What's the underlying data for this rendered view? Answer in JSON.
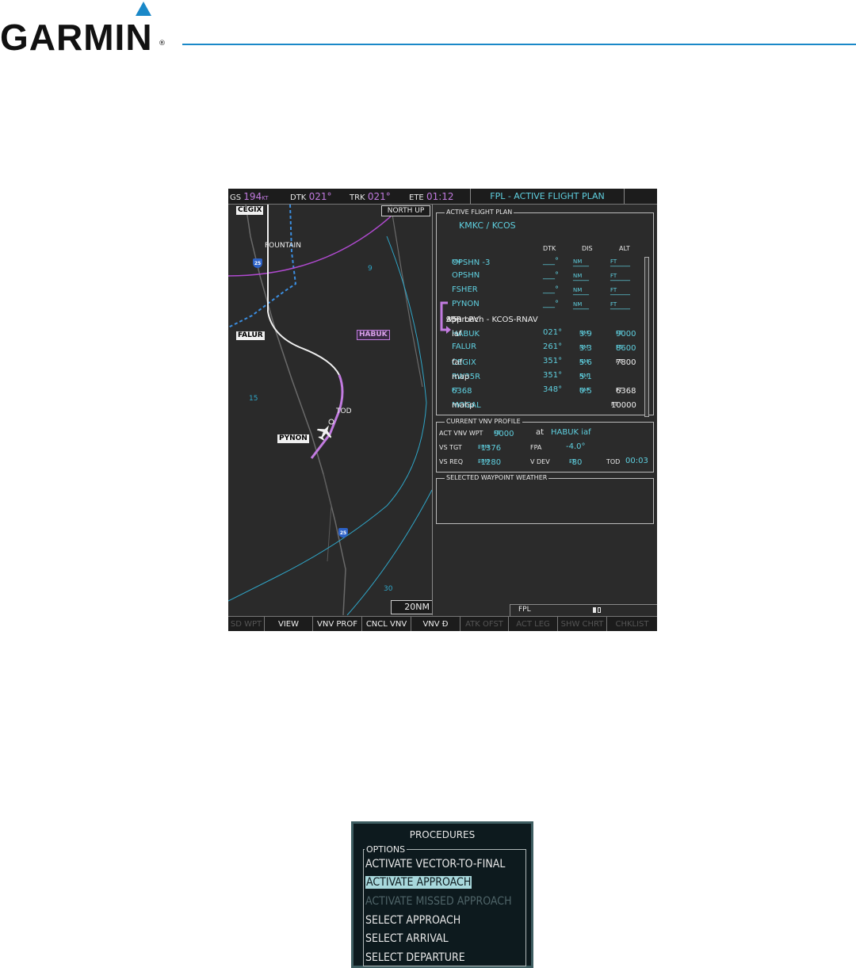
{
  "brand": {
    "logo_text": "GARMIN",
    "registered": "®"
  },
  "top_bar": {
    "gs_label": "GS",
    "gs_value": "194",
    "gs_unit": "KT",
    "dtk_label": "DTK",
    "dtk_value": "021°",
    "trk_label": "TRK",
    "trk_value": "021°",
    "ete_label": "ETE",
    "ete_value": "01:12",
    "page_title": "FPL - ACTIVE FLIGHT PLAN"
  },
  "map": {
    "orientation": "NORTH UP",
    "range": "20NM",
    "waypoints": {
      "cegix": "CEGIX",
      "falur": "FALUR",
      "habuk": "HABUK",
      "pynon": "PYNON"
    },
    "labels": {
      "fountain": "FOUNTAIN",
      "tod": "TOD",
      "ring_9": "9",
      "ring_15": "15",
      "ring_30": "30"
    },
    "highways": [
      "25",
      "25"
    ]
  },
  "flight_plan": {
    "title": "ACTIVE FLIGHT PLAN",
    "route": "KMKC / KCOS",
    "columns": [
      "DTK",
      "DIS",
      "ALT"
    ],
    "rows": [
      {
        "name": "OPSHN -3",
        "name_unit": "NM",
        "dtk": "___°",
        "dis": "____",
        "dis_unit": "NM",
        "alt": "_____",
        "alt_unit": "FT"
      },
      {
        "name": "OPSHN",
        "dtk": "___°",
        "dis": "____",
        "dis_unit": "NM",
        "alt": "_____",
        "alt_unit": "FT"
      },
      {
        "name": "FSHER",
        "dtk": "___°",
        "dis": "____",
        "dis_unit": "NM",
        "alt": "_____",
        "alt_unit": "FT"
      },
      {
        "name": "PYNON",
        "dtk": "___°",
        "dis": "____",
        "dis_unit": "NM",
        "alt": "_____",
        "alt_unit": "FT"
      }
    ],
    "approach_label": "Approach - KCOS-RNAV",
    "approach_gps": "GPS",
    "approach_suffix": "35R LPV",
    "approach_rows": [
      {
        "name": "HABUK",
        "tag": "iaf",
        "dtk": "021°",
        "dis": "3.9",
        "dis_unit": "NM",
        "alt": "9000",
        "alt_unit": "FT"
      },
      {
        "name": "FALUR",
        "tag": "",
        "dtk": "261°",
        "dis": "3.3",
        "dis_unit": "NM",
        "alt": "8600",
        "alt_unit": "FT"
      },
      {
        "name": "CEGIX",
        "tag": "faf",
        "dtk": "351°",
        "dis": "5.6",
        "dis_unit": "NM",
        "alt": "7800",
        "alt_unit": "FT"
      },
      {
        "name": "RW35R",
        "tag": "map",
        "dtk": "351°",
        "dis": "5.1",
        "dis_unit": "NM",
        "alt": "",
        "alt_unit": ""
      },
      {
        "name": "6368",
        "name_unit": "FT",
        "tag": "",
        "dtk": "348°",
        "dis": "0.5",
        "dis_unit": "NM",
        "alt": "6368",
        "alt_unit": "FT"
      },
      {
        "name": "MOGAL",
        "tag": "mahp",
        "dtk": "",
        "dis": "",
        "dis_unit": "",
        "alt": "10000",
        "alt_unit": "FT"
      }
    ]
  },
  "vnv_profile": {
    "title": "CURRENT VNV PROFILE",
    "act_label": "ACT VNV WPT",
    "act_value": "9000",
    "act_unit": "FT",
    "at_label": "at",
    "act_wpt": "HABUK iaf",
    "vs_tgt_label": "VS TGT",
    "vs_tgt_value": "-1376",
    "vs_tgt_unit": "FPM",
    "fpa_label": "FPA",
    "fpa_value": "-4.0°",
    "vs_req_label": "VS REQ",
    "vs_req_value": "-1280",
    "vs_req_unit": "FPM",
    "vdev_label": "V DEV",
    "vdev_value": "-80",
    "vdev_unit": "FT",
    "tod_label": "TOD",
    "tod_value": "00:03"
  },
  "weather": {
    "title": "SELECTED WAYPOINT WEATHER"
  },
  "fpl_strip": {
    "label": "FPL"
  },
  "softkeys": [
    "SD WPT",
    "VIEW",
    "VNV PROF",
    "CNCL VNV",
    "VNV Ð",
    "ATK OFST",
    "ACT LEG",
    "SHW CHRT",
    "CHKLIST"
  ],
  "procedures": {
    "title": "PROCEDURES",
    "options_label": "OPTIONS",
    "items": [
      "ACTIVATE VECTOR-TO-FINAL",
      "ACTIVATE APPROACH",
      "ACTIVATE MISSED APPROACH",
      "SELECT APPROACH",
      "SELECT ARRIVAL",
      "SELECT DEPARTURE"
    ]
  },
  "colors": {
    "garmin_blue": "#1a88c8",
    "magenta": "#c27be0",
    "cyan": "#5fd0e0"
  }
}
